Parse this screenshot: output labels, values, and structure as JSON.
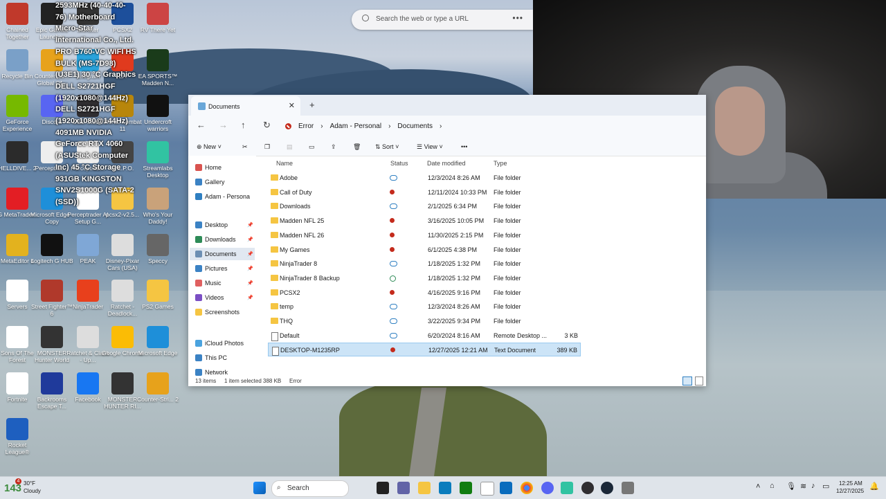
{
  "desktop": {
    "overlay_lines": [
      "2593MHz (40-40-40-",
      "76) Motherboard",
      "Micro-Star",
      "International Co., Ltd.",
      "PRO B760-VC WIFI HS",
      "BULK (MS-7D98)",
      "(U3E1) 30 °C Graphics",
      "DELL S2721HGF",
      "(1920x1080@144Hz)",
      "DELL S2721HGF",
      "(1920x1080@144Hz)",
      "4091MB NVIDIA",
      "GeForce RTX 4060",
      "(ASUStek Computer",
      "Inc) 45 °C Storage",
      "931GB KINGSTON",
      "SNV2S1000G (SATA-2",
      "(SSD))"
    ],
    "icons": [
      {
        "label": "Chained Together",
        "color": "#c0392b"
      },
      {
        "label": "Epic Games Launcher",
        "color": "#222"
      },
      {
        "label": "Monster",
        "color": "#333"
      },
      {
        "label": "PCSX2",
        "color": "#1d4f9b"
      },
      {
        "label": "RV There Yet",
        "color": "#c44"
      },
      {
        "label": "Recycle Bin",
        "color": "#7aa0c8"
      },
      {
        "label": "Counter-Str... Global Of...",
        "color": "#e7a21b"
      },
      {
        "label": "Telegram",
        "color": "#2aa3db"
      },
      {
        "label": "EA",
        "color": "#e03a1e"
      },
      {
        "label": "EA SPORTS™ Madden N...",
        "color": "#1a3b1a"
      },
      {
        "label": "GeForce Experience",
        "color": "#76b900"
      },
      {
        "label": "Discord",
        "color": "#5865f2"
      },
      {
        "label": "OBS Studio",
        "color": "#302e31"
      },
      {
        "label": "Mortal Kombat 11",
        "color": "#b8860b"
      },
      {
        "label": "Undercroft warriors",
        "color": "#111"
      },
      {
        "label": "HELLDIVE... 2",
        "color": "#2b2b2b"
      },
      {
        "label": "Perceptrad...",
        "color": "#eee"
      },
      {
        "label": "Perceptrad...",
        "color": "#eee"
      },
      {
        "label": "R.E.P.O.",
        "color": "#444"
      },
      {
        "label": "Streamlabs Desktop",
        "color": "#31c3a2"
      },
      {
        "label": "IG MetaTrader...",
        "color": "#e31e24"
      },
      {
        "label": "Microsoft Edge - Copy",
        "color": "#1e8fd9"
      },
      {
        "label": "Perceptrader AI Setup G...",
        "color": "#fff"
      },
      {
        "label": "pcsx2-v2.5...",
        "color": "#f5c542"
      },
      {
        "label": "Who's Your Daddy!",
        "color": "#c9a27a"
      },
      {
        "label": "MetaEditor 4",
        "color": "#e3b21e"
      },
      {
        "label": "Logitech G HUB",
        "color": "#111"
      },
      {
        "label": "PEAK",
        "color": "#7fa7d6"
      },
      {
        "label": "Disney-Pixar Cars (USA)",
        "color": "#ddd"
      },
      {
        "label": "Speccy",
        "color": "#666"
      },
      {
        "label": "Servers",
        "color": "#fff"
      },
      {
        "label": "Street Fighter™ 6",
        "color": "#b0392b"
      },
      {
        "label": "NinjaTrader",
        "color": "#e8401c"
      },
      {
        "label": "Ratchet - Deadlock...",
        "color": "#ddd"
      },
      {
        "label": "PS2 Games",
        "color": "#f5c542"
      },
      {
        "label": "Sons Of The Forest",
        "color": "#fff"
      },
      {
        "label": "MONSTER Hunter World",
        "color": "#333"
      },
      {
        "label": "Ratchet & Clank - Up...",
        "color": "#ddd"
      },
      {
        "label": "Google Chrome",
        "color": "#fbbc05"
      },
      {
        "label": "Microsoft Edge",
        "color": "#1e8fd9"
      },
      {
        "label": "Fortnite",
        "color": "#fff"
      },
      {
        "label": "Backrooms Escape T...",
        "color": "#1f3a9b"
      },
      {
        "label": "Facebook",
        "color": "#1877f2"
      },
      {
        "label": "MONSTER HUNTER RI...",
        "color": "#333"
      },
      {
        "label": "Counter-Stri... 2",
        "color": "#e7a21b"
      },
      {
        "label": "Rocket League®",
        "color": "#1e5fbf"
      }
    ]
  },
  "browser_bar": {
    "placeholder": "Search the web or type a URL"
  },
  "explorer": {
    "tab_title": "Documents",
    "breadcrumbs": [
      "Error",
      "Adam - Personal",
      "Documents"
    ],
    "toolbar": {
      "new": "New",
      "sort": "Sort",
      "view": "View"
    },
    "sidebar": [
      {
        "label": "Home",
        "color": "#d9534f"
      },
      {
        "label": "Gallery",
        "color": "#3b82c4"
      },
      {
        "label": "Adam - Persona",
        "color": "#2f7fc1"
      },
      {
        "label": "Desktop",
        "color": "#3b82c4",
        "pinned": true
      },
      {
        "label": "Downloads",
        "color": "#2e8b57",
        "pinned": true
      },
      {
        "label": "Documents",
        "color": "#6d8fb3",
        "pinned": true,
        "selected": true
      },
      {
        "label": "Pictures",
        "color": "#3b82c4",
        "pinned": true
      },
      {
        "label": "Music",
        "color": "#e06060",
        "pinned": true
      },
      {
        "label": "Videos",
        "color": "#7b4fc4",
        "pinned": true
      },
      {
        "label": "Screenshots",
        "color": "#f5c542"
      },
      {
        "label": "iCloud Photos",
        "color": "#4aa3df"
      },
      {
        "label": "This PC",
        "color": "#3b82c4"
      },
      {
        "label": "Network",
        "color": "#3b82c4"
      }
    ],
    "columns": [
      "Name",
      "Status",
      "Date modified",
      "Type"
    ],
    "files": [
      {
        "name": "Adobe",
        "status": "cloud",
        "date": "12/3/2024 8:26 AM",
        "type": "File folder",
        "size": ""
      },
      {
        "name": "Call of Duty",
        "status": "error",
        "date": "12/11/2024 10:33 PM",
        "type": "File folder",
        "size": ""
      },
      {
        "name": "Downloads",
        "status": "cloud",
        "date": "2/1/2025 6:34 PM",
        "type": "File folder",
        "size": ""
      },
      {
        "name": "Madden NFL 25",
        "status": "error",
        "date": "3/16/2025 10:05 PM",
        "type": "File folder",
        "size": ""
      },
      {
        "name": "Madden NFL 26",
        "status": "error",
        "date": "11/30/2025 2:15 PM",
        "type": "File folder",
        "size": ""
      },
      {
        "name": "My Games",
        "status": "error",
        "date": "6/1/2025 4:38 PM",
        "type": "File folder",
        "size": ""
      },
      {
        "name": "NinjaTrader 8",
        "status": "cloud",
        "date": "1/18/2025 1:32 PM",
        "type": "File folder",
        "size": ""
      },
      {
        "name": "NinjaTrader 8 Backup",
        "status": "ok",
        "date": "1/18/2025 1:32 PM",
        "type": "File folder",
        "size": ""
      },
      {
        "name": "PCSX2",
        "status": "error",
        "date": "4/16/2025 9:16 PM",
        "type": "File folder",
        "size": ""
      },
      {
        "name": "temp",
        "status": "cloud",
        "date": "12/3/2024 8:26 AM",
        "type": "File folder",
        "size": ""
      },
      {
        "name": "THQ",
        "status": "cloud",
        "date": "3/22/2025 9:34 PM",
        "type": "File folder",
        "size": ""
      },
      {
        "name": "Default",
        "status": "cloud",
        "date": "6/20/2024 8:16 AM",
        "type": "Remote Desktop ...",
        "size": "3 KB"
      },
      {
        "name": "DESKTOP-M1235RP",
        "status": "error",
        "date": "12/27/2025 12:21 AM",
        "type": "Text Document",
        "size": "389 KB",
        "selected": true
      }
    ],
    "status_bar": {
      "items": "13 items",
      "selected": "1 item selected  388 KB",
      "state": "Error"
    }
  },
  "taskbar": {
    "weather_temp": "30°F",
    "weather_cond": "Cloudy",
    "weather_badge": "143",
    "weather_alert": "4",
    "search": "Search",
    "time": "12:25 AM",
    "date": "12/27/2025"
  }
}
